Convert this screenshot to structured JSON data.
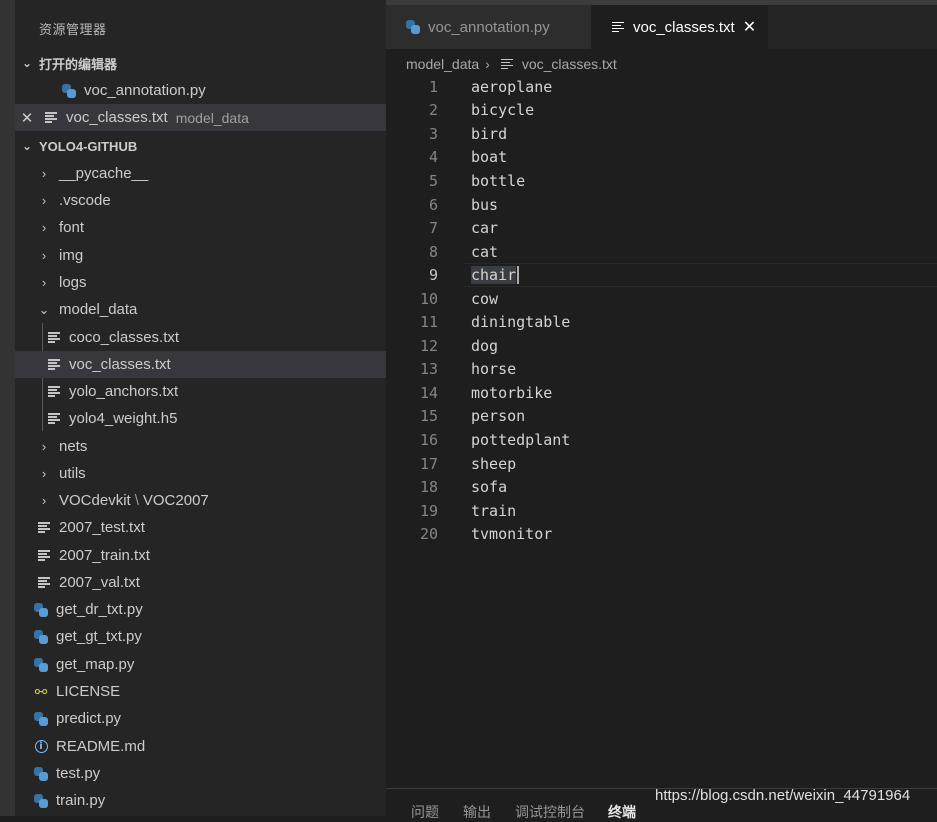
{
  "explorer": {
    "title": "资源管理器",
    "open_editors": {
      "header": "打开的编辑器",
      "items": [
        {
          "name": "voc_annotation.py"
        },
        {
          "name": "voc_classes.txt",
          "desc": "model_data"
        }
      ]
    },
    "project": {
      "header": "YOLO4-GITHUB",
      "items": [
        {
          "name": "__pycache__"
        },
        {
          "name": ".vscode"
        },
        {
          "name": "font"
        },
        {
          "name": "img"
        },
        {
          "name": "logs"
        },
        {
          "name": "model_data"
        },
        {
          "name": "coco_classes.txt"
        },
        {
          "name": "voc_classes.txt"
        },
        {
          "name": "yolo_anchors.txt"
        },
        {
          "name": "yolo4_weight.h5"
        },
        {
          "name": "nets"
        },
        {
          "name": "utils"
        },
        {
          "name": "VOCdevkit",
          "sep": "\\",
          "sub": "VOC2007"
        },
        {
          "name": "2007_test.txt"
        },
        {
          "name": "2007_train.txt"
        },
        {
          "name": "2007_val.txt"
        },
        {
          "name": "get_dr_txt.py"
        },
        {
          "name": "get_gt_txt.py"
        },
        {
          "name": "get_map.py"
        },
        {
          "name": "LICENSE"
        },
        {
          "name": "predict.py"
        },
        {
          "name": "README.md"
        },
        {
          "name": "test.py"
        },
        {
          "name": "train.py"
        }
      ]
    }
  },
  "tabs": [
    {
      "label": "voc_annotation.py"
    },
    {
      "label": "voc_classes.txt"
    }
  ],
  "breadcrumb": {
    "folder": "model_data",
    "file": "voc_classes.txt"
  },
  "code": {
    "lines": [
      {
        "n": "1",
        "text": "aeroplane"
      },
      {
        "n": "2",
        "text": "bicycle"
      },
      {
        "n": "3",
        "text": "bird"
      },
      {
        "n": "4",
        "text": "boat"
      },
      {
        "n": "5",
        "text": "bottle"
      },
      {
        "n": "6",
        "text": "bus"
      },
      {
        "n": "7",
        "text": "car"
      },
      {
        "n": "8",
        "text": "cat"
      },
      {
        "n": "9",
        "text": "chair"
      },
      {
        "n": "10",
        "text": "cow"
      },
      {
        "n": "11",
        "text": "diningtable"
      },
      {
        "n": "12",
        "text": "dog"
      },
      {
        "n": "13",
        "text": "horse"
      },
      {
        "n": "14",
        "text": "motorbike"
      },
      {
        "n": "15",
        "text": "person"
      },
      {
        "n": "16",
        "text": "pottedplant"
      },
      {
        "n": "17",
        "text": "sheep"
      },
      {
        "n": "18",
        "text": "sofa"
      },
      {
        "n": "19",
        "text": "train"
      },
      {
        "n": "20",
        "text": "tvmonitor"
      }
    ]
  },
  "panel": {
    "tabs": [
      "问题",
      "输出",
      "调试控制台",
      "终端"
    ]
  },
  "watermark": "https://blog.csdn.net/weixin_44791964",
  "colors": {
    "python": "#3572a5",
    "selection": "#37373d",
    "background": "#1e1e1e"
  }
}
